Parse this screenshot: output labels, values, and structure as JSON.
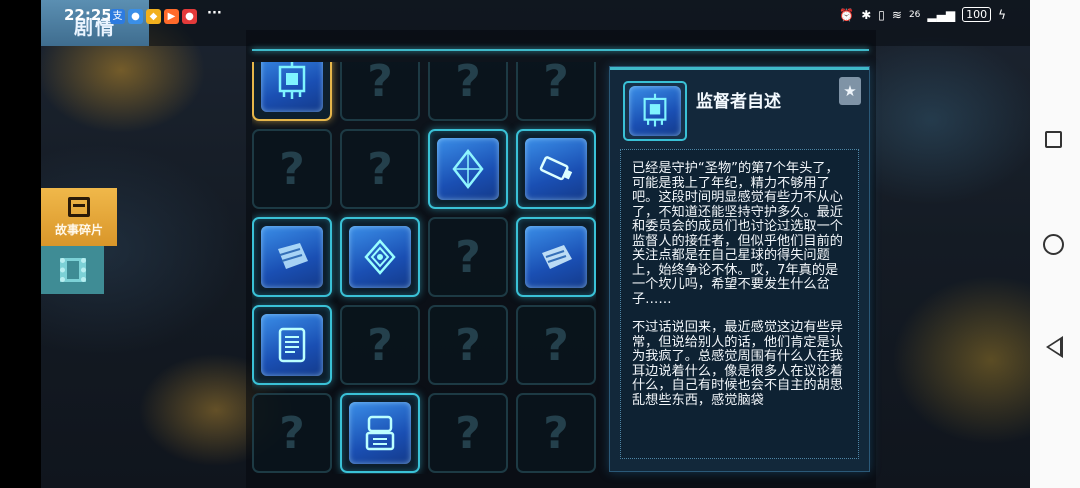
{
  "status_bar": {
    "time": "22:25",
    "more": "···",
    "network_speed": "26",
    "battery": "100"
  },
  "header": {
    "title": "剧情"
  },
  "side_tabs": [
    {
      "label": "故事碎片",
      "icon": "document-icon",
      "active": true
    },
    {
      "label": "",
      "icon": "film-icon",
      "active": false
    }
  ],
  "grid": {
    "cells": [
      {
        "state": "item",
        "icon": "circuit-board-icon",
        "selected": true
      },
      {
        "state": "locked",
        "label": "?"
      },
      {
        "state": "locked",
        "label": "?"
      },
      {
        "state": "locked",
        "label": "?"
      },
      {
        "state": "locked",
        "label": "?"
      },
      {
        "state": "locked",
        "label": "?"
      },
      {
        "state": "item",
        "icon": "crystal-icon"
      },
      {
        "state": "item",
        "icon": "usb-drive-icon"
      },
      {
        "state": "item",
        "icon": "book-icon"
      },
      {
        "state": "item",
        "icon": "emblem-icon"
      },
      {
        "state": "locked",
        "label": "?"
      },
      {
        "state": "item",
        "icon": "notebook-icon"
      },
      {
        "state": "item",
        "icon": "tablet-icon"
      },
      {
        "state": "locked",
        "label": "?"
      },
      {
        "state": "locked",
        "label": "?"
      },
      {
        "state": "locked",
        "label": "?"
      },
      {
        "state": "locked",
        "label": "?"
      },
      {
        "state": "item",
        "icon": "robot-icon"
      },
      {
        "state": "locked",
        "label": "?"
      },
      {
        "state": "locked",
        "label": "?"
      }
    ]
  },
  "detail": {
    "title": "监督者自述",
    "star_icon": "star-icon",
    "paragraphs": [
      "已经是守护“圣物”的第7个年头了，可能是我上了年纪，精力不够用了吧。这段时间明显感觉有些力不从心了，不知道还能坚持守护多久。最近和委员会的成员们也讨论过选取一个监督人的接任者，但似乎他们目前的关注点都是在自己星球的得失问题上，始终争论不休。哎，7年真的是一个坎儿吗，希望不要发生什么岔子……",
      "不过话说回来，最近感觉这边有些异常，但说给别人的话，他们肯定是认为我疯了。总感觉周围有什么人在我耳边说着什么，像是很多人在议论着什么，自己有时候也会不自主的胡思乱想些东西，感觉脑袋"
    ]
  },
  "colors": {
    "accent": "#3fb9c9",
    "selected": "#e6b64a",
    "tab_active": "#f0b84a",
    "close": "#c8463c"
  }
}
